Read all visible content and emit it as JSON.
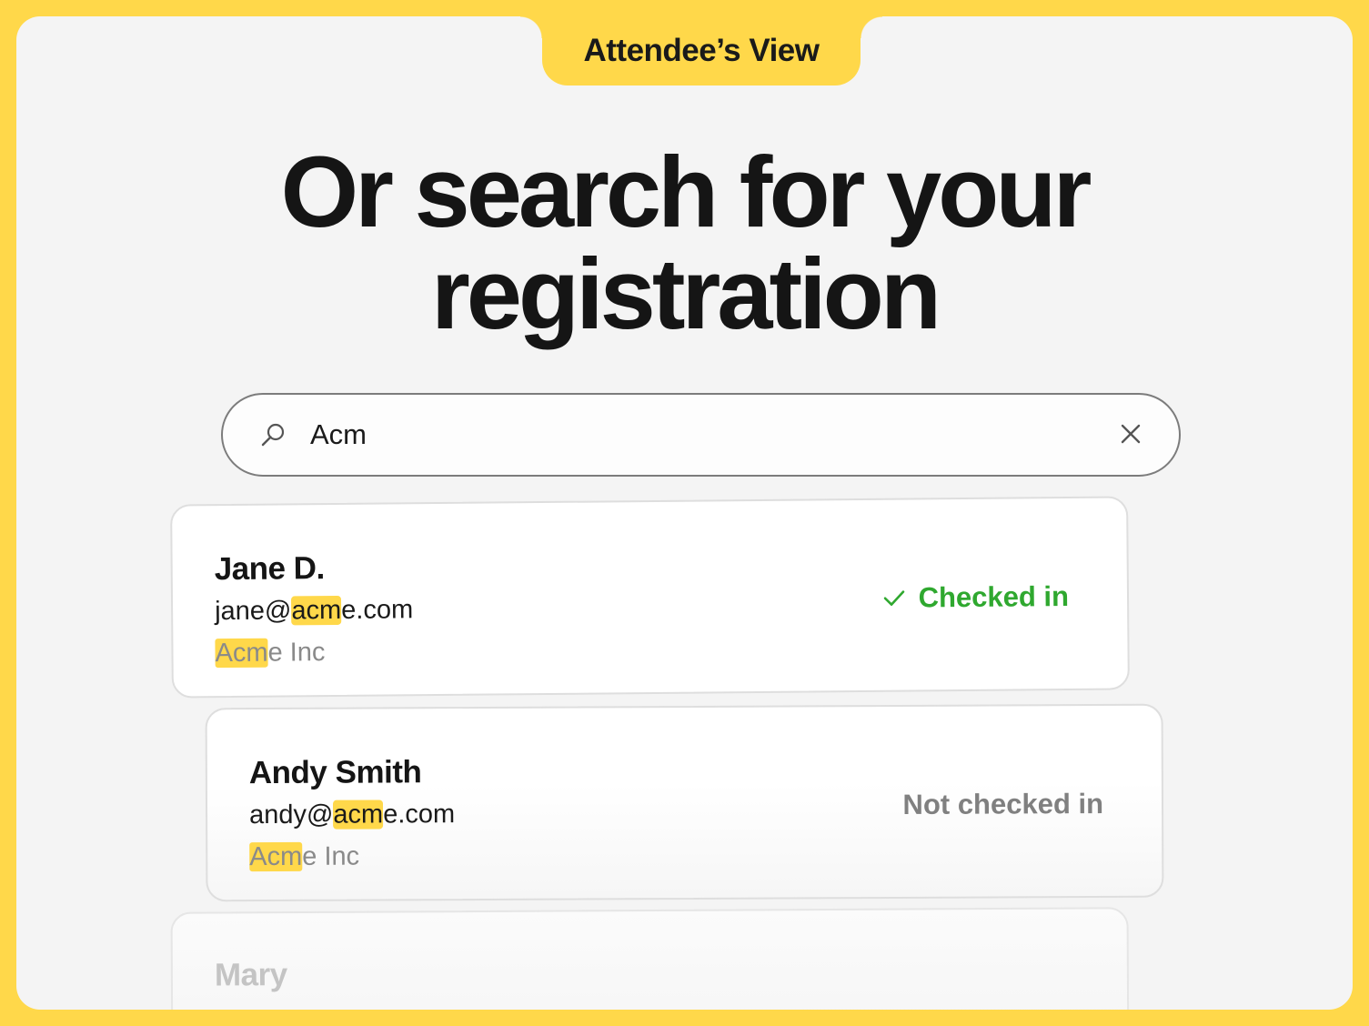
{
  "header": {
    "tab_label": "Attendee’s View"
  },
  "page": {
    "title": "Or search for your registration"
  },
  "search": {
    "value": "Acm"
  },
  "results": [
    {
      "name": "Jane D.",
      "email_prefix": "jane@",
      "email_match": "acm",
      "email_suffix": "e.com",
      "company_match": "Acm",
      "company_suffix": "e Inc",
      "status": "Checked in"
    },
    {
      "name": "Andy Smith",
      "email_prefix": "andy@",
      "email_match": "acm",
      "email_suffix": "e.com",
      "company_match": "Acm",
      "company_suffix": "e Inc",
      "status": "Not checked in"
    },
    {
      "name": "Mary"
    }
  ],
  "colors": {
    "accent": "#ffd84a",
    "checked_in": "#2fa82f",
    "not_checked_in": "#808080",
    "background": "#f4f4f4"
  },
  "icons": {
    "search": "search-icon",
    "clear": "close-icon",
    "check": "check-icon"
  }
}
